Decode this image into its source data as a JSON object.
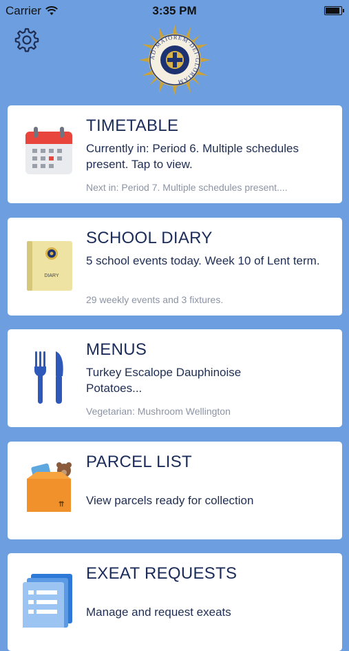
{
  "status_bar": {
    "carrier": "Carrier",
    "time": "3:35 PM"
  },
  "header": {
    "settings_icon": "gear-icon",
    "crest_text": "AD·MAIOREM·DEI·GLORIAM"
  },
  "cards": [
    {
      "title": "TIMETABLE",
      "description": "Currently in: Period 6. Multiple schedules present. Tap to view.",
      "subtitle": "Next in: Period 7. Multiple schedules present....",
      "icon": "calendar-icon"
    },
    {
      "title": "SCHOOL DIARY",
      "description": "5 school events today. Week 10 of Lent term.",
      "subtitle": "29 weekly events and 3 fixtures.",
      "icon": "diary-book-icon",
      "icon_label": "DIARY"
    },
    {
      "title": "MENUS",
      "description": "Turkey Escalope Dauphinoise Potatoes...",
      "subtitle": "Vegetarian: Mushroom Wellington",
      "icon": "fork-knife-icon"
    },
    {
      "title": "PARCEL LIST",
      "description": "View parcels ready for collection",
      "subtitle": "",
      "icon": "parcel-box-icon"
    },
    {
      "title": "EXEAT REQUESTS",
      "description": "Manage and request exeats",
      "subtitle": "",
      "icon": "forms-icon"
    }
  ],
  "colors": {
    "background": "#6d9fe0",
    "card": "#ffffff",
    "title": "#1b2c5a",
    "subtitle": "#8c94a3"
  }
}
